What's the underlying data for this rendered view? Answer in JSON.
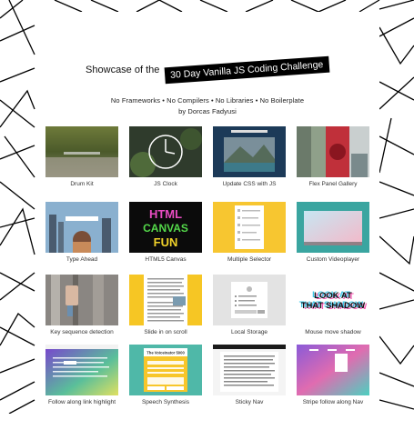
{
  "header": {
    "title_prefix": "Showcase of the",
    "title_badge": "30 Day Vanilla JS Coding Challenge",
    "subtitle": "No Frameworks • No Compilers • No Libraries • No Boilerplate",
    "byline": "by Dorcas Fadyusi"
  },
  "tiles": [
    {
      "caption": "Drum Kit",
      "icon": "drum-kit-thumbnail"
    },
    {
      "caption": "JS Clock",
      "icon": "clock-thumbnail"
    },
    {
      "caption": "Update CSS with JS",
      "icon": "css-variables-thumbnail"
    },
    {
      "caption": "Flex Panel Gallery",
      "icon": "flex-panels-thumbnail"
    },
    {
      "caption": "Type Ahead",
      "icon": "type-ahead-thumbnail"
    },
    {
      "caption": "HTML5 Canvas",
      "icon": "canvas-thumbnail"
    },
    {
      "caption": "Multiple Selector",
      "icon": "checkboxes-thumbnail"
    },
    {
      "caption": "Custom Videoplayer",
      "icon": "video-player-thumbnail"
    },
    {
      "caption": "Key sequence detection",
      "icon": "key-detection-thumbnail"
    },
    {
      "caption": "Slide in on scroll",
      "icon": "slide-in-thumbnail"
    },
    {
      "caption": "Local Storage",
      "icon": "local-storage-thumbnail"
    },
    {
      "caption": "Mouse move shadow",
      "icon": "shadow-text-thumbnail"
    },
    {
      "caption": "Follow along link highlight",
      "icon": "highlighter-thumbnail"
    },
    {
      "caption": "Speech Synthesis",
      "icon": "speech-synthesis-thumbnail"
    },
    {
      "caption": "Sticky Nav",
      "icon": "sticky-nav-thumbnail"
    },
    {
      "caption": "Stripe follow along Nav",
      "icon": "stripe-nav-thumbnail"
    }
  ],
  "thumb_texts": {
    "canvas_words": [
      "HTML",
      "CANVAS",
      "FUN"
    ],
    "shadow_words": [
      "LOOK AT",
      "THAT SHADOW"
    ],
    "speech_title": "The Voiceinator 5000"
  },
  "colors": {
    "badge_bg": "#000000",
    "checkbox_yellow": "#f7c630",
    "video_teal": "#3aa5a0",
    "speech_teal": "#4fb8a8",
    "slide_yellow": "#f6c624"
  }
}
